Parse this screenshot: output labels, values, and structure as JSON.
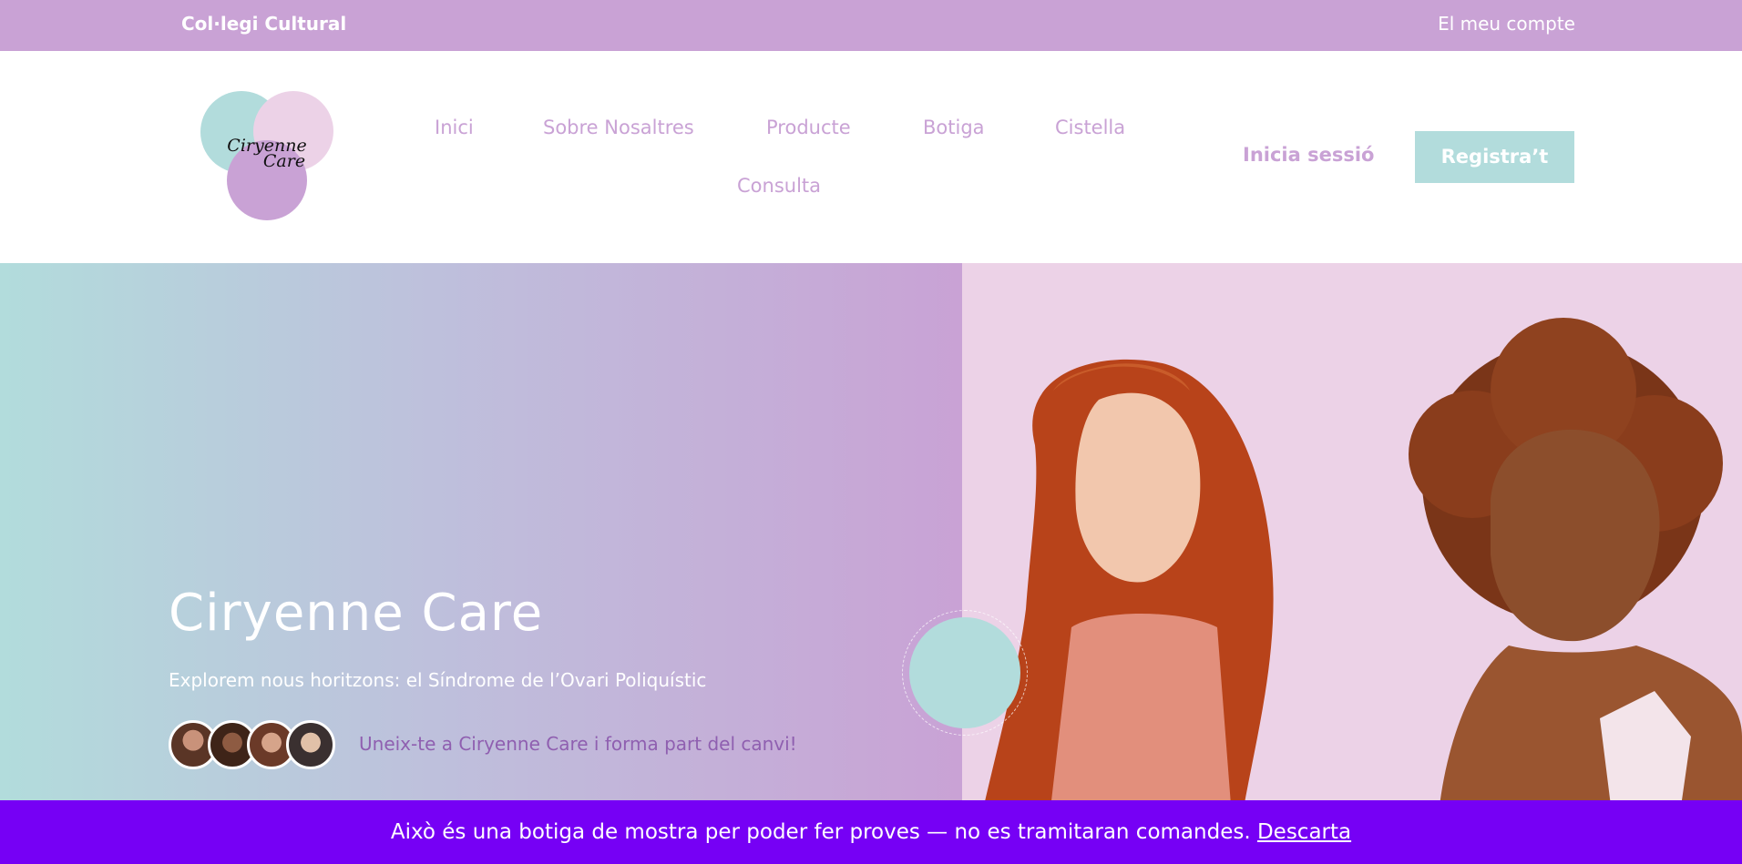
{
  "topbar": {
    "site_name": "Col·legi Cultural",
    "account_link": "El meu compte"
  },
  "header": {
    "logo": {
      "line1": "Ciryenne",
      "line2": "Care"
    },
    "nav": [
      {
        "label": "Inici"
      },
      {
        "label": "Sobre Nosaltres"
      },
      {
        "label": "Producte"
      },
      {
        "label": "Botiga"
      },
      {
        "label": "Cistella"
      },
      {
        "label": "Consulta"
      }
    ],
    "login_label": "Inicia sessió",
    "register_label": "Registra’t"
  },
  "hero": {
    "title": "Ciryenne Care",
    "subtitle": "Explorem nous horitzons: el Síndrome de l’Ovari Poliquístic",
    "join_text": "Uneix-te a Ciryenne Care i forma part del canvi!"
  },
  "notice": {
    "text": "Això és una botiga de mostra per poder fer proves — no es tramitaran comandes.",
    "dismiss_label": "Descarta"
  },
  "colors": {
    "lilac": "#c9a2d5",
    "mint": "#b2dcdc",
    "pink": "#ecd2e7",
    "notice_bg": "#7600f5",
    "join_text": "#8f5fb0"
  }
}
